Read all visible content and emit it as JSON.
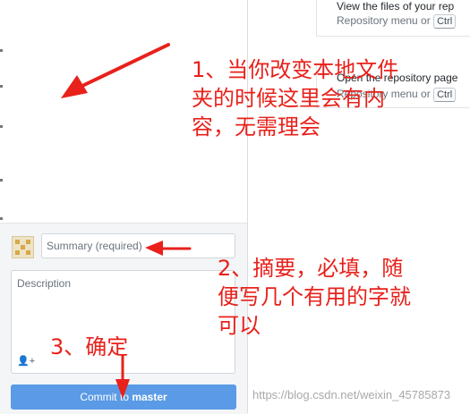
{
  "commit_panel": {
    "summary_placeholder": "Summary (required)",
    "description_placeholder": "Description",
    "commit_button_prefix": "Commit to ",
    "commit_button_branch": "master"
  },
  "hints": [
    {
      "title": "View the files of your rep",
      "subtitle": "Repository menu or",
      "shortcut": "Ctrl"
    },
    {
      "title": "Open the repository page",
      "subtitle": "Repository menu or",
      "shortcut": "Ctrl"
    }
  ],
  "annotations": {
    "note1": "1、当你改变本地文件\n夹的时候这里会有内\n容，无需理会",
    "note2": "2、摘要，必填，随\n便写几个有用的字就\n可以",
    "note3": "3、确定"
  },
  "colors": {
    "annotation": "#e8211b",
    "commit_button": "#5a9ae6"
  },
  "watermark": "https://blog.csdn.net/weixin_45785873"
}
